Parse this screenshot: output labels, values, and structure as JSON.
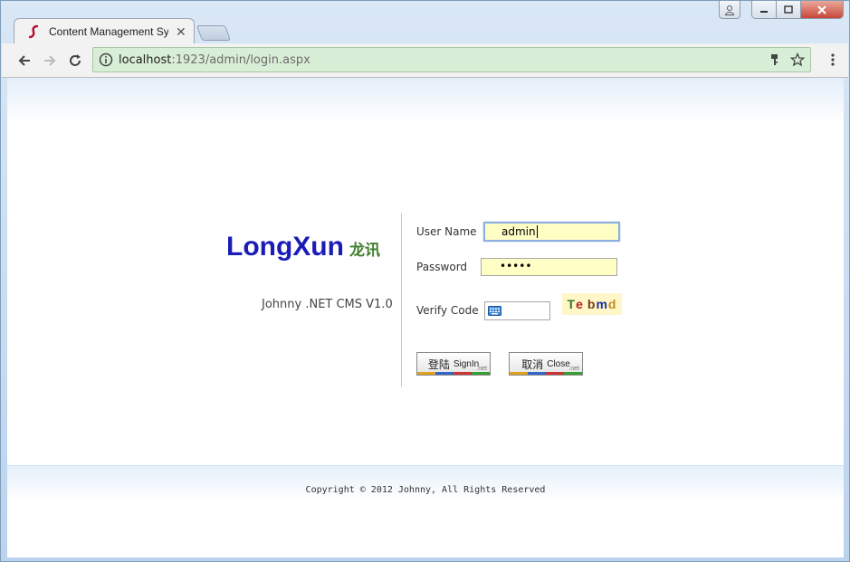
{
  "browser": {
    "tab_title": "Content Management Sy",
    "url_host": "localhost",
    "url_path": ":1923/admin/login.aspx"
  },
  "brand": {
    "name": "LongXun",
    "name_cn": "龙讯",
    "subtitle": "Johnny .NET CMS V1.0"
  },
  "form": {
    "username_label": "User Name",
    "username_value": "admin",
    "password_label": "Password",
    "password_value": "•••••",
    "verify_label": "Verify Code",
    "verify_value": "",
    "captcha_chars": [
      "T",
      "e",
      "b",
      "m",
      "d"
    ],
    "captcha_colors": [
      "#2f7a1f",
      "#b02020",
      "#7a3a10",
      "#1a2f9f",
      "#c08a20"
    ]
  },
  "buttons": {
    "signin_cn": "登陆",
    "signin_en": "SignIn",
    "close_cn": "取消",
    "close_en": "Close",
    "net_tag": ".net"
  },
  "footer": {
    "copyright": "Copyright © 2012 Johnny, All Rights Reserved"
  },
  "colors": {
    "brand_blue": "#1b1bb8",
    "brand_green": "#3f7d2d",
    "input_bg": "#fefec5",
    "secure_bar": "#d9eed6"
  }
}
